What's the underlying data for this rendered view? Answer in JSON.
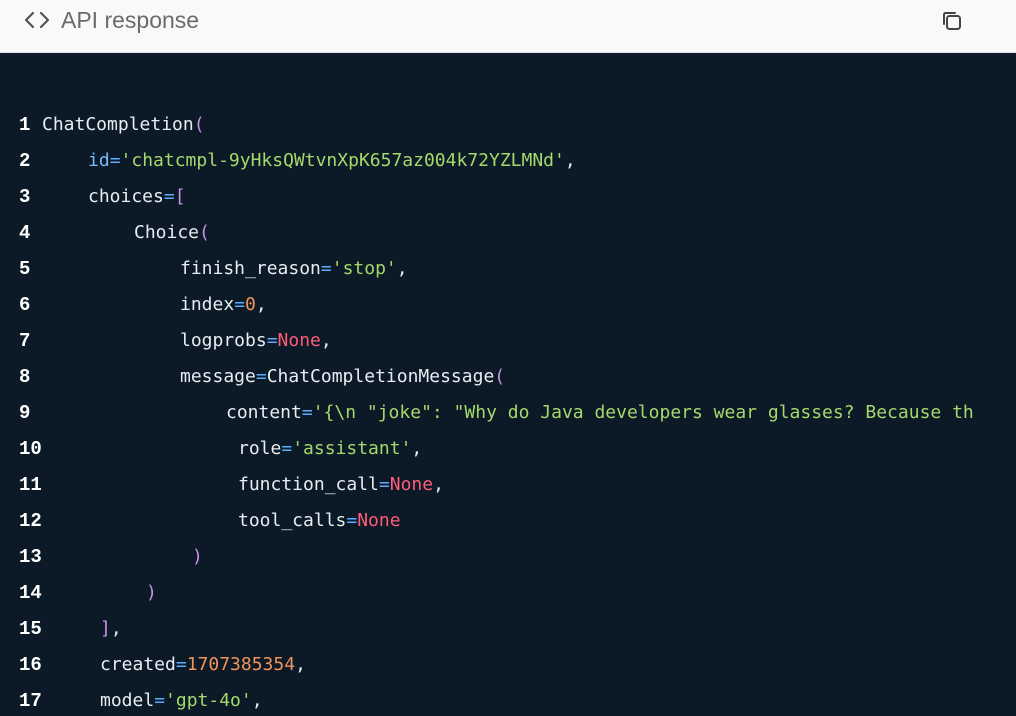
{
  "header": {
    "title": "API response",
    "code_icon": "code-brackets-icon",
    "copy_icon": "copy-icon"
  },
  "lines": [
    {
      "n": "1",
      "indent": 42,
      "tokens": [
        [
          "t-attr",
          "ChatCompletion"
        ],
        [
          "t-br",
          "("
        ]
      ]
    },
    {
      "n": "2",
      "indent": 88,
      "tokens": [
        [
          "t-id",
          "id"
        ],
        [
          "t-op",
          "="
        ],
        [
          "t-str",
          "'chatcmpl-9yHksQWtvnXpK657az004k72YZLMNd'"
        ],
        [
          "t-attr",
          ","
        ]
      ]
    },
    {
      "n": "3",
      "indent": 88,
      "tokens": [
        [
          "t-attr",
          "choices"
        ],
        [
          "t-op",
          "="
        ],
        [
          "t-br",
          "["
        ]
      ]
    },
    {
      "n": "4",
      "indent": 134,
      "tokens": [
        [
          "t-attr",
          "Choice"
        ],
        [
          "t-br",
          "("
        ]
      ]
    },
    {
      "n": "5",
      "indent": 180,
      "tokens": [
        [
          "t-attr",
          "finish_reason"
        ],
        [
          "t-op",
          "="
        ],
        [
          "t-str",
          "'stop'"
        ],
        [
          "t-attr",
          ","
        ]
      ]
    },
    {
      "n": "6",
      "indent": 180,
      "tokens": [
        [
          "t-attr",
          "index"
        ],
        [
          "t-op",
          "="
        ],
        [
          "t-num",
          "0"
        ],
        [
          "t-attr",
          ","
        ]
      ]
    },
    {
      "n": "7",
      "indent": 180,
      "tokens": [
        [
          "t-attr",
          "logprobs"
        ],
        [
          "t-op",
          "="
        ],
        [
          "t-kw",
          "None"
        ],
        [
          "t-attr",
          ","
        ]
      ]
    },
    {
      "n": "8",
      "indent": 180,
      "tokens": [
        [
          "t-attr",
          "message"
        ],
        [
          "t-op",
          "="
        ],
        [
          "t-attr",
          "ChatCompletionMessage"
        ],
        [
          "t-br",
          "("
        ]
      ]
    },
    {
      "n": "9",
      "indent": 226,
      "tokens": [
        [
          "t-attr",
          "content"
        ],
        [
          "t-op",
          "="
        ],
        [
          "t-str",
          "'{\\n \"joke\": \"Why do Java developers wear glasses? Because th"
        ]
      ]
    },
    {
      "n": "10",
      "indent": 238,
      "tokens": [
        [
          "t-attr",
          "role"
        ],
        [
          "t-op",
          "="
        ],
        [
          "t-str",
          "'assistant'"
        ],
        [
          "t-attr",
          ","
        ]
      ]
    },
    {
      "n": "11",
      "indent": 238,
      "tokens": [
        [
          "t-attr",
          "function_call"
        ],
        [
          "t-op",
          "="
        ],
        [
          "t-kw",
          "None"
        ],
        [
          "t-attr",
          ","
        ]
      ]
    },
    {
      "n": "12",
      "indent": 238,
      "tokens": [
        [
          "t-attr",
          "tool_calls"
        ],
        [
          "t-op",
          "="
        ],
        [
          "t-kw",
          "None"
        ]
      ]
    },
    {
      "n": "13",
      "indent": 192,
      "tokens": [
        [
          "t-br",
          ")"
        ]
      ]
    },
    {
      "n": "14",
      "indent": 146,
      "tokens": [
        [
          "t-br",
          ")"
        ]
      ]
    },
    {
      "n": "15",
      "indent": 100,
      "tokens": [
        [
          "t-br",
          "]"
        ],
        [
          "t-attr",
          ","
        ]
      ]
    },
    {
      "n": "16",
      "indent": 100,
      "tokens": [
        [
          "t-attr",
          "created"
        ],
        [
          "t-op",
          "="
        ],
        [
          "t-num",
          "1707385354"
        ],
        [
          "t-attr",
          ","
        ]
      ]
    },
    {
      "n": "17",
      "indent": 100,
      "tokens": [
        [
          "t-attr",
          "model"
        ],
        [
          "t-op",
          "="
        ],
        [
          "t-str",
          "'gpt-4o'"
        ],
        [
          "t-attr",
          ","
        ]
      ]
    }
  ]
}
